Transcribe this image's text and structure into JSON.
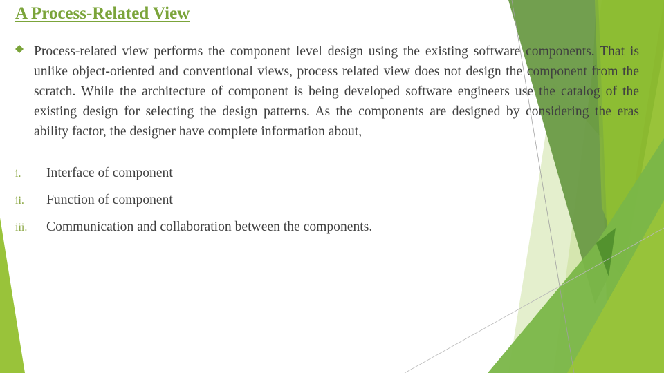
{
  "slide": {
    "title": "A Process-Related View",
    "bullet": {
      "icon": "diamond-bullet-icon",
      "text": "Process-related view performs the component level design using the existing software components. That is unlike object-oriented and conventional views, process related view does not design the component from the scratch. While the architecture of component is being developed software engineers use the catalog of the existing design for selecting the design patterns. As the components are designed by considering the eras ability factor, the designer have complete information about,"
    },
    "list": [
      {
        "number": "i.",
        "text": "Interface of component"
      },
      {
        "number": "ii.",
        "text": "Function of component"
      },
      {
        "number": "iii.",
        "text": "Communication and collaboration between the components."
      }
    ]
  },
  "theme": {
    "accent": "#7ba43a",
    "dark_green": "#6a9a46",
    "mid_green": "#7ab648",
    "light_green": "#99c33a",
    "pale_green": "#dfecc4",
    "text": "#404040"
  }
}
